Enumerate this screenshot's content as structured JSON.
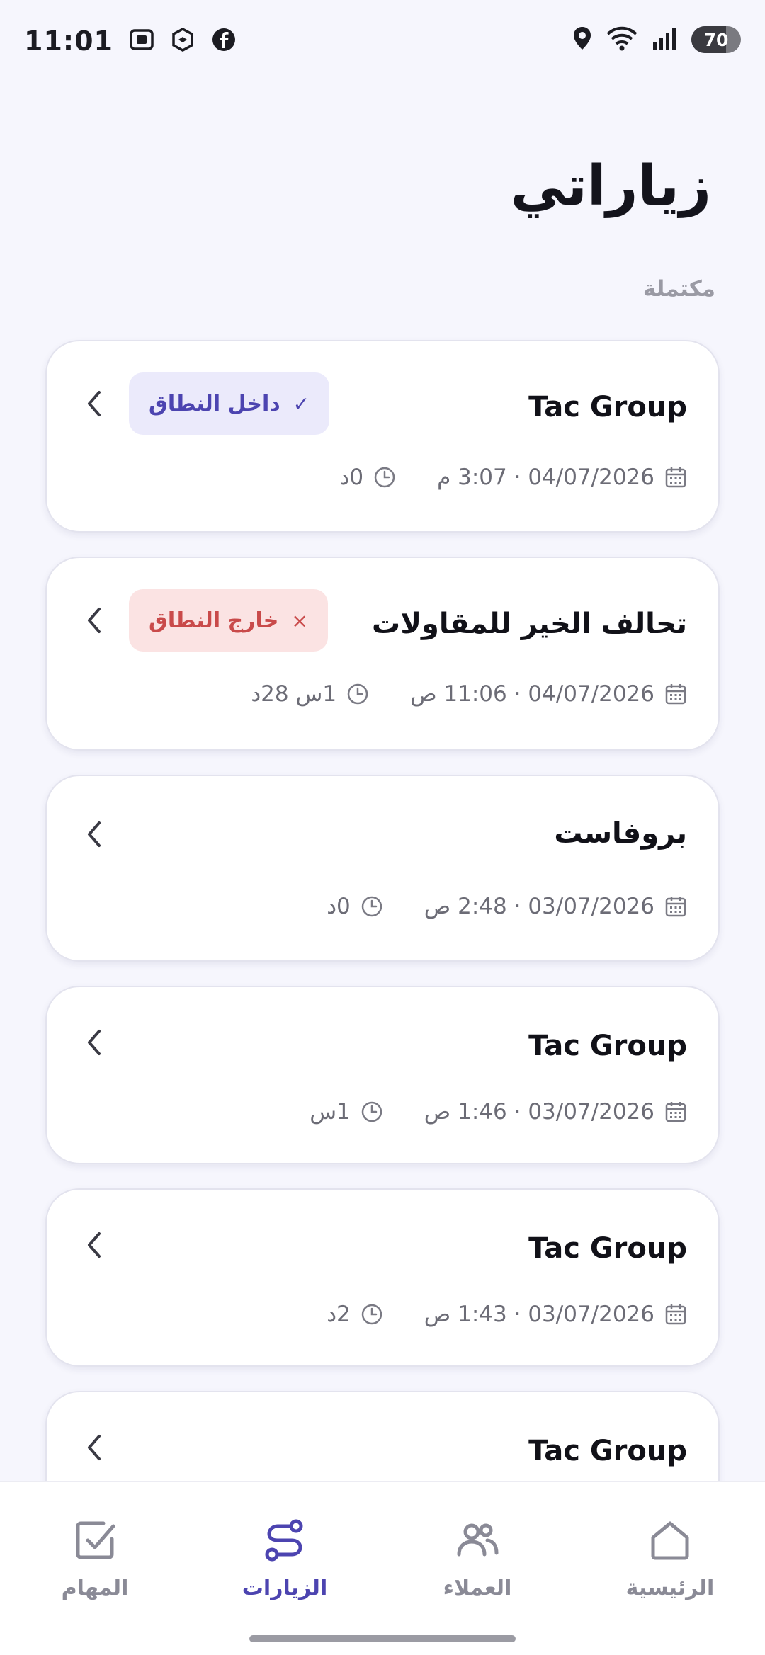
{
  "status_bar": {
    "time": "11:01",
    "battery": "70",
    "battery_level": 0.7,
    "icons": [
      "screenshot-icon",
      "shield-app-icon",
      "facebook-icon",
      "location-icon",
      "wifi-icon",
      "signal-icon",
      "battery-icon"
    ]
  },
  "header": {
    "title": "زياراتي",
    "section": "مكتملة"
  },
  "visits": [
    {
      "name": "Tac Group",
      "datetime": "04/07/2026 · 3:07 م",
      "duration": "0د",
      "badge": "داخل النطاق",
      "badge_type": "in",
      "badge_mark": "✓"
    },
    {
      "name": "تحالف الخير للمقاولات",
      "datetime": "04/07/2026 · 11:06 ص",
      "duration": "1س 28د",
      "badge": "خارج النطاق",
      "badge_type": "out",
      "badge_mark": "×"
    },
    {
      "name": "بروفاست",
      "datetime": "03/07/2026 · 2:48 ص",
      "duration": "0د"
    },
    {
      "name": "Tac Group",
      "datetime": "03/07/2026 · 1:46 ص",
      "duration": "1س"
    },
    {
      "name": "Tac Group",
      "datetime": "03/07/2026 · 1:43 ص",
      "duration": "2د"
    },
    {
      "name": "Tac Group"
    }
  ],
  "nav": {
    "tasks": "المهام",
    "visits": "الزيارات",
    "clients": "العملاء",
    "home": "الرئيسية",
    "active": "visits"
  },
  "colors": {
    "accent": "#4c44b0",
    "in_range_bg": "#ebeafb",
    "out_range_bg": "#fbe3e3",
    "out_range_text": "#c94a4a",
    "background": "#f6f6fd"
  }
}
